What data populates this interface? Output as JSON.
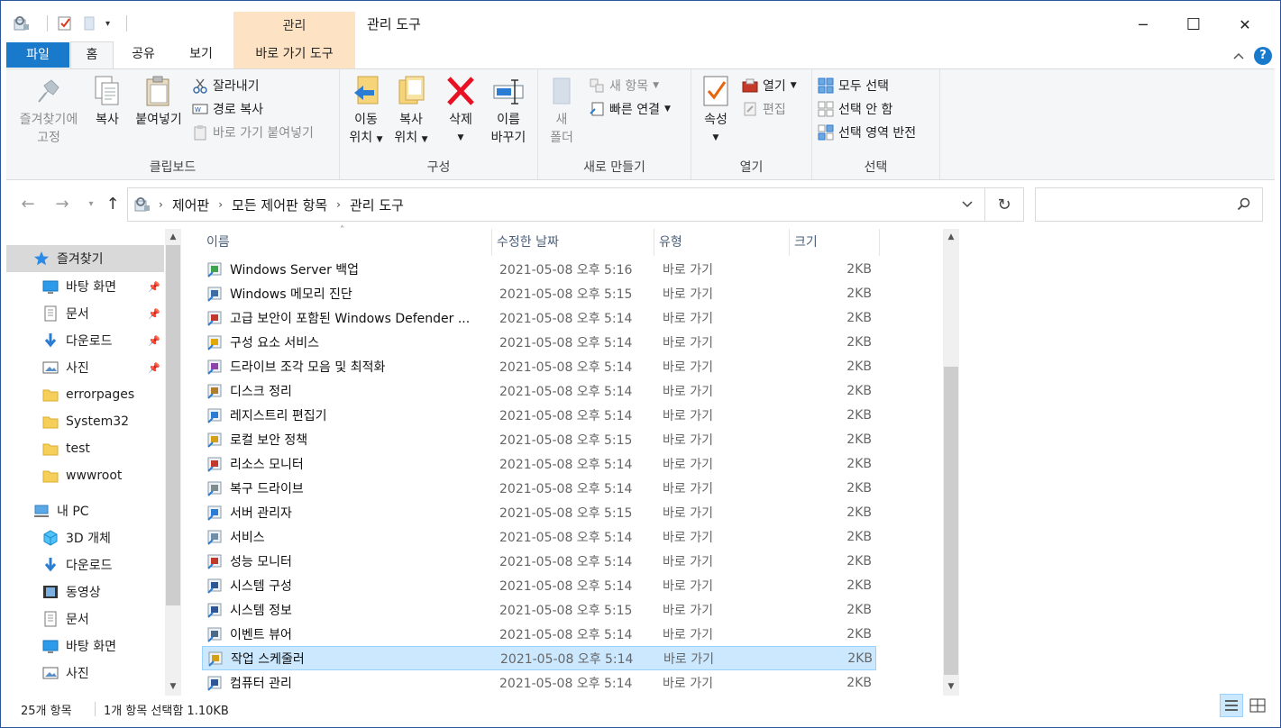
{
  "titlebar": {
    "context_tab_header": "관리",
    "title": "관리 도구",
    "minimize": "─",
    "maximize": "☐",
    "close": "✕"
  },
  "tabs": {
    "file": "파일",
    "home": "홈",
    "share": "공유",
    "view": "보기",
    "context": "바로 가기 도구"
  },
  "ribbon": {
    "clipboard": {
      "label": "클립보드",
      "pin": "즐겨찾기에\n고정",
      "pin_line1": "즐겨찾기에",
      "pin_line2": "고정",
      "copy": "복사",
      "paste": "붙여넣기",
      "cut": "잘라내기",
      "copy_path": "경로 복사",
      "paste_shortcut": "바로 가기 붙여넣기"
    },
    "organize": {
      "label": "구성",
      "move_line1": "이동",
      "move_line2": "위치",
      "copy_line1": "복사",
      "copy_line2": "위치",
      "delete": "삭제",
      "rename_line1": "이름",
      "rename_line2": "바꾸기"
    },
    "new": {
      "label": "새로 만들기",
      "folder_line1": "새",
      "folder_line2": "폴더",
      "new_item": "새 항목",
      "easy_access": "빠른 연결"
    },
    "open": {
      "label": "열기",
      "properties": "속성",
      "open": "열기",
      "edit": "편집"
    },
    "select": {
      "label": "선택",
      "select_all": "모두 선택",
      "select_none": "선택 안 함",
      "invert": "선택 영역 반전"
    }
  },
  "address": {
    "crumbs": [
      "제어판",
      "모든 제어판 항목",
      "관리 도구"
    ],
    "search_placeholder": ""
  },
  "nav": {
    "quick_access": "즐겨찾기",
    "items": [
      {
        "label": "바탕 화면",
        "pinned": true,
        "icon": "desktop-icon"
      },
      {
        "label": "문서",
        "pinned": true,
        "icon": "document-icon"
      },
      {
        "label": "다운로드",
        "pinned": true,
        "icon": "download-icon"
      },
      {
        "label": "사진",
        "pinned": true,
        "icon": "pictures-icon"
      },
      {
        "label": "errorpages",
        "pinned": false,
        "icon": "folder-icon"
      },
      {
        "label": "System32",
        "pinned": false,
        "icon": "folder-icon"
      },
      {
        "label": "test",
        "pinned": false,
        "icon": "folder-icon"
      },
      {
        "label": "wwwroot",
        "pinned": false,
        "icon": "folder-icon"
      }
    ],
    "this_pc": "내 PC",
    "pc_items": [
      {
        "label": "3D 개체",
        "icon": "3d-objects-icon"
      },
      {
        "label": "다운로드",
        "icon": "download-icon"
      },
      {
        "label": "동영상",
        "icon": "videos-icon"
      },
      {
        "label": "문서",
        "icon": "document-icon"
      },
      {
        "label": "바탕 화면",
        "icon": "desktop-icon"
      },
      {
        "label": "사진",
        "icon": "pictures-icon"
      }
    ]
  },
  "columns": {
    "name": "이름",
    "date": "수정한 날짜",
    "type": "유형",
    "size": "크기"
  },
  "files": [
    {
      "name": "Windows Server 백업",
      "date": "2021-05-08 오후 5:16",
      "type": "바로 가기",
      "size": "2KB",
      "icon": "backup-icon"
    },
    {
      "name": "Windows 메모리 진단",
      "date": "2021-05-08 오후 5:15",
      "type": "바로 가기",
      "size": "2KB",
      "icon": "memory-diagnostic-icon"
    },
    {
      "name": "고급 보안이 포함된 Windows Defender ...",
      "date": "2021-05-08 오후 5:14",
      "type": "바로 가기",
      "size": "2KB",
      "icon": "firewall-icon"
    },
    {
      "name": "구성 요소 서비스",
      "date": "2021-05-08 오후 5:14",
      "type": "바로 가기",
      "size": "2KB",
      "icon": "component-services-icon"
    },
    {
      "name": "드라이브 조각 모음 및 최적화",
      "date": "2021-05-08 오후 5:14",
      "type": "바로 가기",
      "size": "2KB",
      "icon": "defrag-icon"
    },
    {
      "name": "디스크 정리",
      "date": "2021-05-08 오후 5:14",
      "type": "바로 가기",
      "size": "2KB",
      "icon": "disk-cleanup-icon"
    },
    {
      "name": "레지스트리 편집기",
      "date": "2021-05-08 오후 5:14",
      "type": "바로 가기",
      "size": "2KB",
      "icon": "registry-icon"
    },
    {
      "name": "로컬 보안 정책",
      "date": "2021-05-08 오후 5:15",
      "type": "바로 가기",
      "size": "2KB",
      "icon": "security-policy-icon"
    },
    {
      "name": "리소스 모니터",
      "date": "2021-05-08 오후 5:14",
      "type": "바로 가기",
      "size": "2KB",
      "icon": "resource-monitor-icon"
    },
    {
      "name": "복구 드라이브",
      "date": "2021-05-08 오후 5:14",
      "type": "바로 가기",
      "size": "2KB",
      "icon": "recovery-drive-icon"
    },
    {
      "name": "서버 관리자",
      "date": "2021-05-08 오후 5:15",
      "type": "바로 가기",
      "size": "2KB",
      "icon": "server-manager-icon"
    },
    {
      "name": "서비스",
      "date": "2021-05-08 오후 5:14",
      "type": "바로 가기",
      "size": "2KB",
      "icon": "services-icon"
    },
    {
      "name": "성능 모니터",
      "date": "2021-05-08 오후 5:14",
      "type": "바로 가기",
      "size": "2KB",
      "icon": "performance-monitor-icon"
    },
    {
      "name": "시스템 구성",
      "date": "2021-05-08 오후 5:14",
      "type": "바로 가기",
      "size": "2KB",
      "icon": "system-config-icon"
    },
    {
      "name": "시스템 정보",
      "date": "2021-05-08 오후 5:15",
      "type": "바로 가기",
      "size": "2KB",
      "icon": "system-info-icon"
    },
    {
      "name": "이벤트 뷰어",
      "date": "2021-05-08 오후 5:14",
      "type": "바로 가기",
      "size": "2KB",
      "icon": "event-viewer-icon"
    },
    {
      "name": "작업 스케줄러",
      "date": "2021-05-08 오후 5:14",
      "type": "바로 가기",
      "size": "2KB",
      "icon": "task-scheduler-icon",
      "selected": true
    },
    {
      "name": "컴퓨터 관리",
      "date": "2021-05-08 오후 5:14",
      "type": "바로 가기",
      "size": "2KB",
      "icon": "computer-management-icon"
    }
  ],
  "status": {
    "count": "25개 항목",
    "selection": "1개 항목 선택함 1.10KB"
  },
  "colors": {
    "accent": "#1979ca",
    "selection_bg": "#cce8ff",
    "context_tab": "#fde3c4"
  }
}
